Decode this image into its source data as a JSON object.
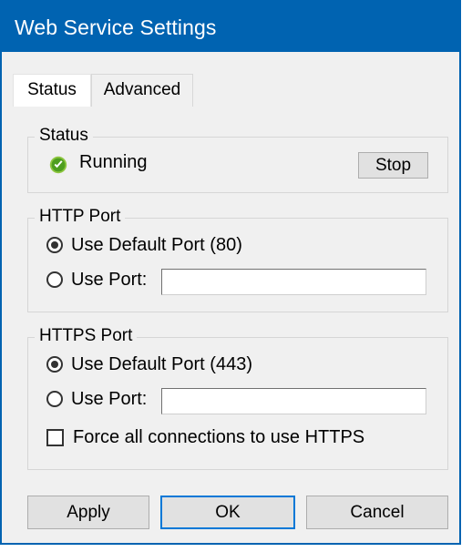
{
  "window": {
    "title": "Web Service Settings",
    "titlebar_color": "#0063b1",
    "border_color": "#0063b1",
    "client_background": "#f0f0f0"
  },
  "tabs": [
    {
      "label": "Status",
      "selected": true
    },
    {
      "label": "Advanced",
      "selected": false
    }
  ],
  "status_group": {
    "legend": "Status",
    "icon": "green-check-circle-icon",
    "icon_color": "#5cb32b",
    "state_text": "Running",
    "action_button": "Stop"
  },
  "http_group": {
    "legend": "HTTP Port",
    "default_option": {
      "label": "Use Default Port (80)",
      "selected": true
    },
    "custom_option": {
      "label": "Use Port:",
      "selected": false
    },
    "port_input": {
      "value": "",
      "placeholder": ""
    }
  },
  "https_group": {
    "legend": "HTTPS Port",
    "default_option": {
      "label": "Use Default Port (443)",
      "selected": true
    },
    "custom_option": {
      "label": "Use Port:",
      "selected": false
    },
    "port_input": {
      "value": "",
      "placeholder": ""
    },
    "force_https": {
      "label": "Force all connections to use HTTPS",
      "checked": false
    }
  },
  "footer": {
    "apply_label": "Apply",
    "ok_label": "OK",
    "cancel_label": "Cancel",
    "default_button": "OK",
    "focus_color": "#0078d7"
  }
}
